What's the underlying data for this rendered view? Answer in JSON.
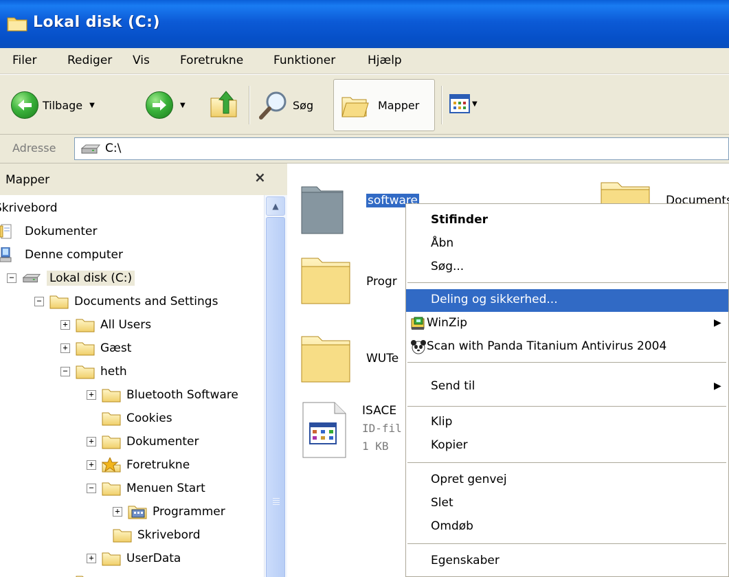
{
  "window": {
    "title": "Lokal disk (C:)"
  },
  "menubar": {
    "items": [
      "Filer",
      "Rediger",
      "Vis",
      "Foretrukne",
      "Funktioner",
      "Hjælp"
    ]
  },
  "toolbar": {
    "back_label": "Tilbage",
    "search_label": "Søg",
    "folders_label": "Mapper"
  },
  "address": {
    "label": "Adresse",
    "value": "C:\\"
  },
  "folder_pane": {
    "title": "Mapper",
    "close": "×",
    "tree": [
      {
        "label": "Skrivebord"
      },
      {
        "label": "Dokumenter"
      },
      {
        "label": "Denne computer"
      },
      {
        "label": "Lokal disk (C:)"
      },
      {
        "label": "Documents and Settings"
      },
      {
        "label": "All Users"
      },
      {
        "label": "Gæst"
      },
      {
        "label": "heth"
      },
      {
        "label": "Bluetooth Software"
      },
      {
        "label": "Cookies"
      },
      {
        "label": "Dokumenter"
      },
      {
        "label": "Foretrukne"
      },
      {
        "label": "Menuen Start"
      },
      {
        "label": "Programmer"
      },
      {
        "label": "Skrivebord"
      },
      {
        "label": "UserData"
      }
    ]
  },
  "content": {
    "items": [
      {
        "name": "software"
      },
      {
        "name": "Documents"
      },
      {
        "name": "Progr"
      },
      {
        "name": "WUTe"
      },
      {
        "name": "ISACE",
        "type": "ID-fil",
        "size": "1 KB"
      }
    ]
  },
  "context_menu": {
    "items": [
      {
        "label": "Stifinder"
      },
      {
        "label": "Åbn"
      },
      {
        "label": "Søg..."
      },
      {
        "label": "Deling og sikkerhed..."
      },
      {
        "label": "WinZip"
      },
      {
        "label": "Scan with Panda Titanium Antivirus 2004"
      },
      {
        "label": "Send til"
      },
      {
        "label": "Klip"
      },
      {
        "label": "Kopier"
      },
      {
        "label": "Opret genvej"
      },
      {
        "label": "Slet"
      },
      {
        "label": "Omdøb"
      },
      {
        "label": "Egenskaber"
      }
    ]
  },
  "colors": {
    "titlebar": "#0c5ad6",
    "selection": "#316ac5",
    "chrome": "#ece9d8"
  }
}
